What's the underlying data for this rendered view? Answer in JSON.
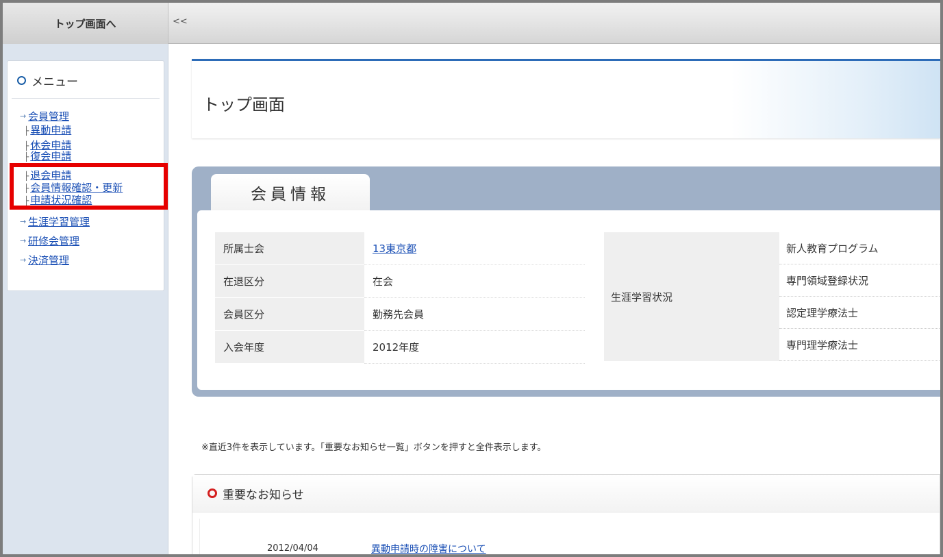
{
  "topbar": {
    "home_label": "トップ画面へ",
    "collapse_label": "<<"
  },
  "menu": {
    "title": "メニュー",
    "groups": [
      {
        "label": "会員管理",
        "items": [
          "異動申請",
          "休会申請",
          "復会申請",
          "退会申請",
          "会員情報確認・更新",
          "申請状況確認"
        ]
      },
      {
        "label": "生涯学習管理"
      },
      {
        "label": "研修会管理"
      },
      {
        "label": "決済管理"
      }
    ]
  },
  "page": {
    "title": "トップ画面"
  },
  "member_info": {
    "tab_label": "会員情報",
    "rows": [
      {
        "label": "所属士会",
        "value": "13東京都"
      },
      {
        "label": "在退区分",
        "value": "在会"
      },
      {
        "label": "会員区分",
        "value": "勤務先会員"
      },
      {
        "label": "入会年度",
        "value": "2012年度"
      }
    ],
    "lifelong": {
      "label": "生涯学習状況",
      "items": [
        "新人教育プログラム",
        "専門領域登録状況",
        "認定理学療法士",
        "専門理学療法士"
      ]
    }
  },
  "notice": {
    "note": "※直近3件を表示しています。「重要なお知らせ一覧」ボタンを押すと全件表示します。",
    "title": "重要なお知らせ",
    "items": [
      {
        "date": "2012/04/04",
        "title": "異動申請時の障害について"
      }
    ]
  },
  "colors": {
    "accent": "#2d6cb8",
    "highlight": "#e60000",
    "panel": "#9fb0c7",
    "sidebar": "#dce4ee"
  }
}
